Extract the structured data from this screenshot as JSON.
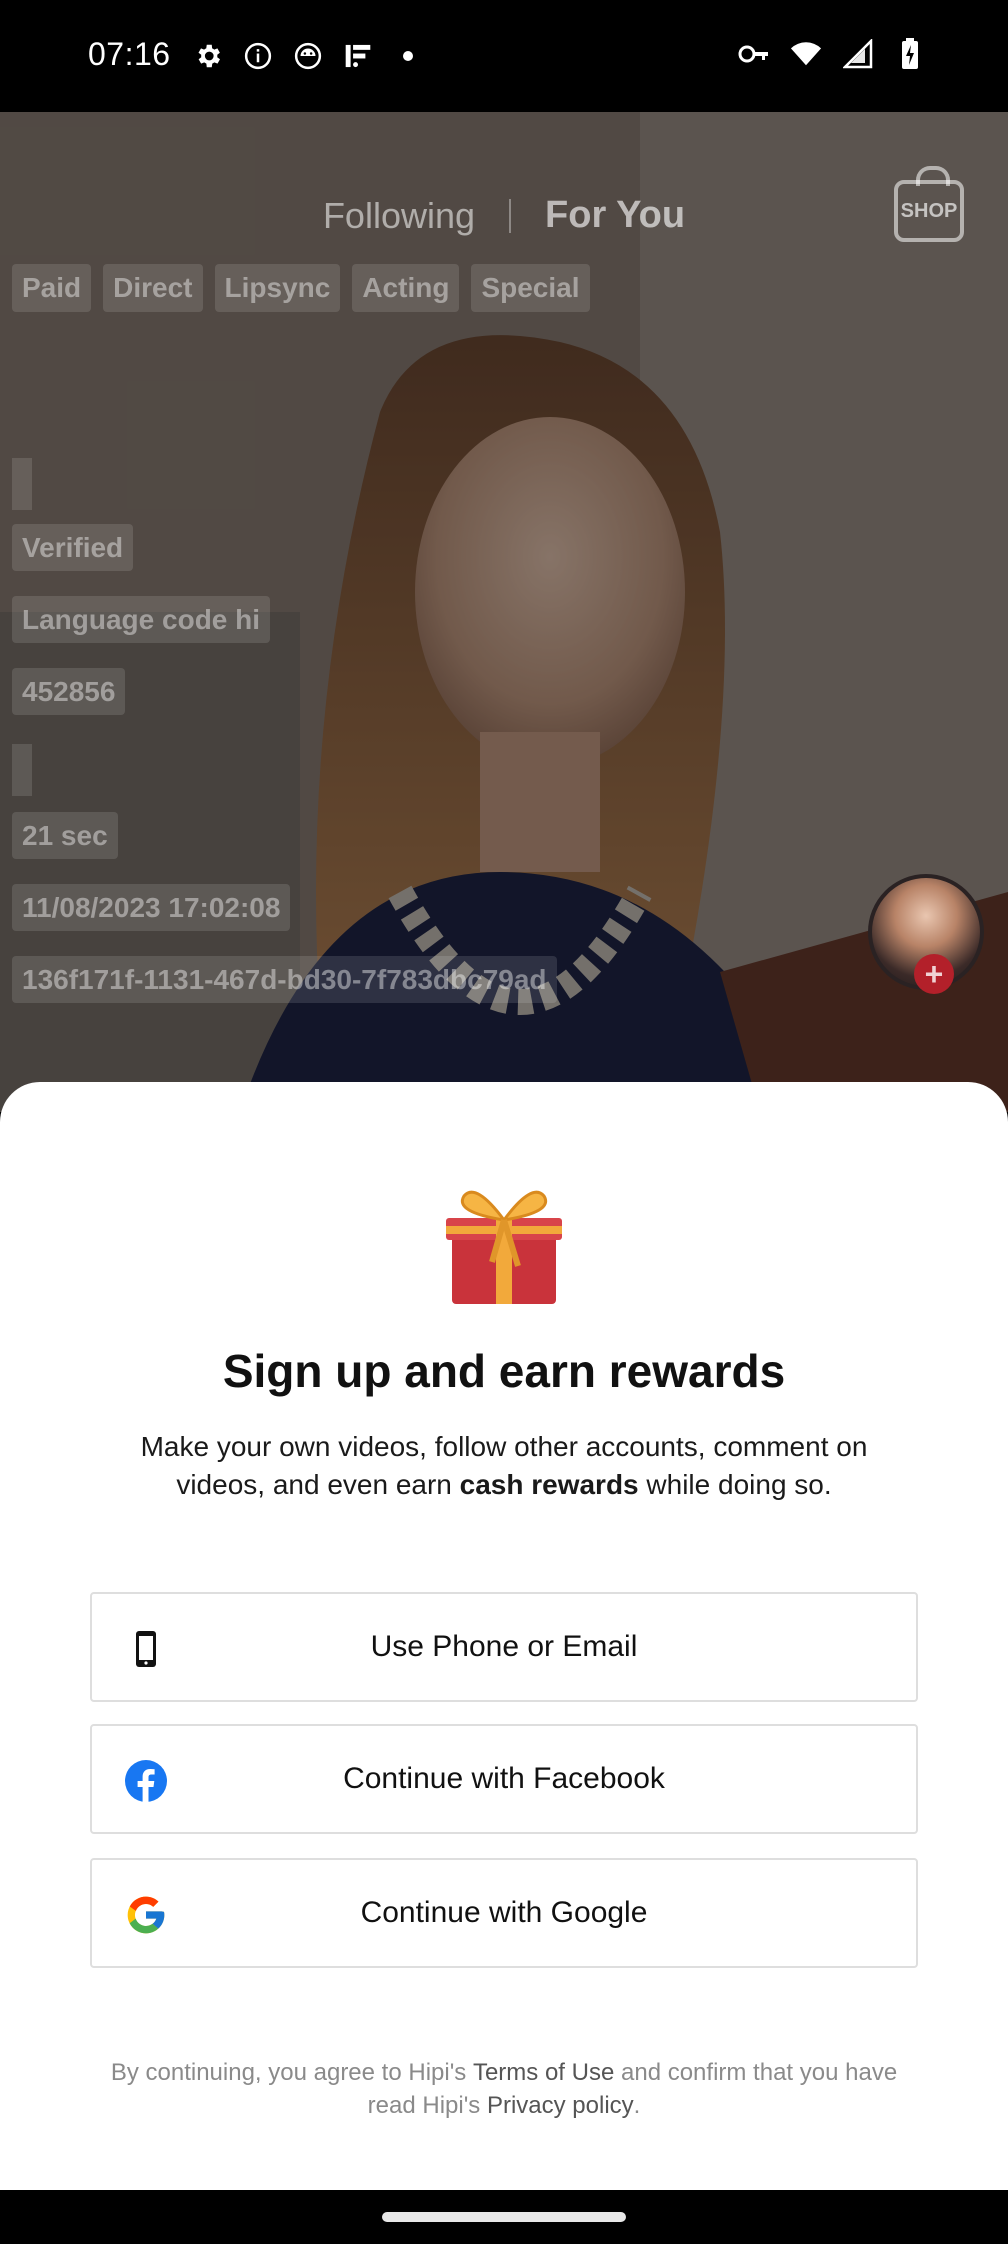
{
  "status_bar": {
    "time": "07:16",
    "left_icons": [
      "settings-icon",
      "info-icon",
      "android-icon",
      "app-notification-icon",
      "dot-icon"
    ],
    "right_icons": [
      "vpn-key-icon",
      "wifi-icon",
      "cell-signal-icon",
      "battery-charging-icon"
    ]
  },
  "feed": {
    "tabs": [
      {
        "label": "Following",
        "active": false
      },
      {
        "label": "For You",
        "active": true
      }
    ],
    "shop_label": "SHOP",
    "debug_chips_row": [
      "Paid",
      "Direct",
      "Lipsync",
      "Acting",
      "Special"
    ],
    "debug_chips": [
      "Verified",
      "Language code hi",
      "452856",
      "21 sec",
      "11/08/2023 17:02:08",
      "136f171f-1131-467d-bd30-7f783dbc79ad"
    ],
    "avatar_plus": "+"
  },
  "sheet": {
    "title": "Sign up and earn rewards",
    "description_part1": "Make your own videos, follow other accounts, comment on videos, and even earn ",
    "description_bold": "cash rewards",
    "description_part2": " while doing so.",
    "buttons": [
      {
        "label": "Use Phone or Email",
        "icon": "phone-icon"
      },
      {
        "label": "Continue with Facebook",
        "icon": "facebook-icon"
      },
      {
        "label": "Continue with Google",
        "icon": "google-icon"
      }
    ],
    "terms": {
      "prefix": "By continuing, you agree to Hipi's ",
      "terms_link": "Terms of Use",
      "middle": " and confirm that you have read Hipi's ",
      "privacy_link": "Privacy policy",
      "suffix": "."
    }
  },
  "colors": {
    "facebook_blue": "#1877F2",
    "avatar_plus_red": "#B3202A",
    "sheet_bg": "#FFFFFF",
    "button_border": "#DEDEDE"
  }
}
